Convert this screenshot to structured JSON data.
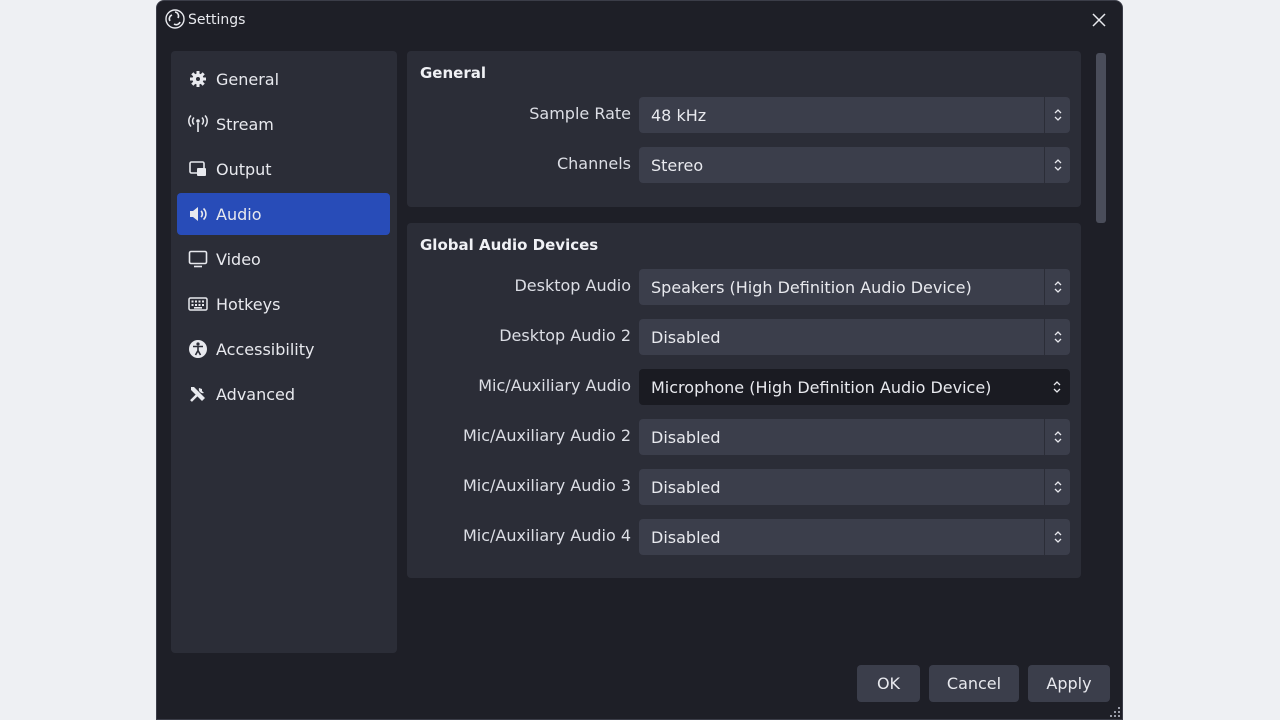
{
  "window": {
    "title": "Settings"
  },
  "sidebar": {
    "items": [
      {
        "label": "General",
        "icon": "gear-icon"
      },
      {
        "label": "Stream",
        "icon": "antenna-icon"
      },
      {
        "label": "Output",
        "icon": "output-icon"
      },
      {
        "label": "Audio",
        "icon": "speaker-icon",
        "active": true
      },
      {
        "label": "Video",
        "icon": "monitor-icon"
      },
      {
        "label": "Hotkeys",
        "icon": "keyboard-icon"
      },
      {
        "label": "Accessibility",
        "icon": "accessibility-icon"
      },
      {
        "label": "Advanced",
        "icon": "tools-icon"
      }
    ]
  },
  "general": {
    "title": "General",
    "sample_rate": {
      "label": "Sample Rate",
      "value": "48 kHz"
    },
    "channels": {
      "label": "Channels",
      "value": "Stereo"
    }
  },
  "global_audio": {
    "title": "Global Audio Devices",
    "rows": [
      {
        "label": "Desktop Audio",
        "value": "Speakers (High Definition Audio Device)"
      },
      {
        "label": "Desktop Audio 2",
        "value": "Disabled"
      },
      {
        "label": "Mic/Auxiliary Audio",
        "value": "Microphone (High Definition Audio Device)"
      },
      {
        "label": "Mic/Auxiliary Audio 2",
        "value": "Disabled"
      },
      {
        "label": "Mic/Auxiliary Audio 3",
        "value": "Disabled"
      },
      {
        "label": "Mic/Auxiliary Audio 4",
        "value": "Disabled"
      }
    ]
  },
  "buttons": {
    "ok": "OK",
    "cancel": "Cancel",
    "apply": "Apply"
  },
  "colors": {
    "window_bg": "#1e1f27",
    "panel_bg": "#2b2d37",
    "accent": "#284cb8",
    "control_bg": "#3b3e4b"
  }
}
